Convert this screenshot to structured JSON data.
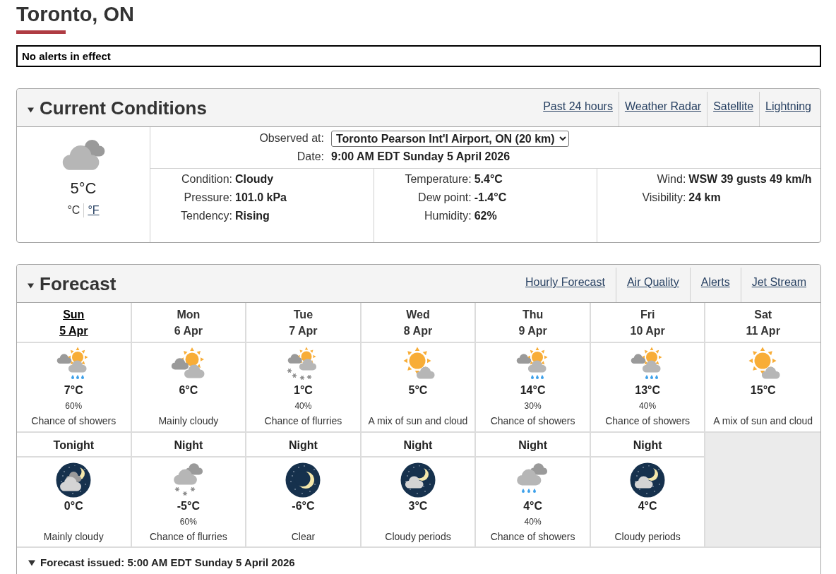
{
  "location": {
    "title": "Toronto, ON"
  },
  "alert_banner": {
    "text": "No alerts in effect"
  },
  "current_conditions": {
    "title": "Current Conditions",
    "expanded": true,
    "links": [
      "Past 24 hours",
      "Weather Radar",
      "Satellite",
      "Lightning"
    ],
    "temperature": "5°C",
    "units": [
      {
        "label": "°C",
        "selected": true
      },
      {
        "label": "°F",
        "selected": false
      }
    ],
    "station": {
      "label": "Observed at:",
      "value": "Toronto Pearson Int'l Airport, ON (20 km)"
    },
    "date": {
      "label": "Date:",
      "value": "9:00 AM EDT Sunday 5 April 2026"
    },
    "details": [
      [
        {
          "label": "Condition:",
          "value": "Cloudy"
        },
        {
          "label": "Pressure:",
          "value": "101.0 kPa"
        },
        {
          "label": "Tendency:",
          "value": "Rising"
        }
      ],
      [
        {
          "label": "Temperature:",
          "value": "5.4°C"
        },
        {
          "label": "Dew point:",
          "value": "-1.4°C"
        },
        {
          "label": "Humidity:",
          "value": "62%"
        }
      ],
      [
        {
          "label": "Wind:",
          "value": "WSW 39 gusts 49 km/h"
        },
        {
          "label": "Visibility:",
          "value": "24 km"
        }
      ]
    ]
  },
  "forecast": {
    "title": "Forecast",
    "expanded": true,
    "links": [
      "Hourly Forecast",
      "Air Quality",
      "Alerts",
      "Jet Stream"
    ],
    "days": [
      {
        "day": "Sun",
        "date": "5 Apr",
        "selected": true,
        "kind": "sunshowers",
        "temperature": "7°C",
        "pop": "60%",
        "summary": "Chance of showers"
      },
      {
        "day": "Mon",
        "date": "6 Apr",
        "selected": false,
        "kind": "suncloudy",
        "temperature": "6°C",
        "summary": "Mainly cloudy"
      },
      {
        "day": "Tue",
        "date": "7 Apr",
        "selected": false,
        "kind": "sunflurries",
        "temperature": "1°C",
        "pop": "40%",
        "summary": "Chance of flurries"
      },
      {
        "day": "Wed",
        "date": "8 Apr",
        "selected": false,
        "kind": "suncloud",
        "temperature": "5°C",
        "summary": "A mix of sun and cloud"
      },
      {
        "day": "Thu",
        "date": "9 Apr",
        "selected": false,
        "kind": "sunshowers",
        "temperature": "14°C",
        "pop": "30%",
        "summary": "Chance of showers"
      },
      {
        "day": "Fri",
        "date": "10 Apr",
        "selected": false,
        "kind": "sunshowers",
        "temperature": "13°C",
        "pop": "40%",
        "summary": "Chance of showers"
      },
      {
        "day": "Sat",
        "date": "11 Apr",
        "selected": false,
        "kind": "suncloud",
        "temperature": "15°C",
        "summary": "A mix of sun and cloud"
      }
    ],
    "nights": [
      {
        "label": "Tonight",
        "kind": "moonclouds",
        "temperature": "0°C",
        "summary": "Mainly cloudy"
      },
      {
        "label": "Night",
        "kind": "flurries",
        "temperature": "-5°C",
        "pop": "60%",
        "summary": "Chance of flurries"
      },
      {
        "label": "Night",
        "kind": "moon",
        "temperature": "-6°C",
        "summary": "Clear"
      },
      {
        "label": "Night",
        "kind": "mooncloud",
        "temperature": "3°C",
        "summary": "Cloudy periods"
      },
      {
        "label": "Night",
        "kind": "showers",
        "temperature": "4°C",
        "pop": "40%",
        "summary": "Chance of showers"
      },
      {
        "label": "Night",
        "kind": "mooncloud",
        "temperature": "4°C",
        "summary": "Cloudy periods"
      }
    ],
    "issued": {
      "text": "Forecast issued: 5:00 AM EDT Sunday 5 April 2026",
      "expanded": true
    }
  }
}
